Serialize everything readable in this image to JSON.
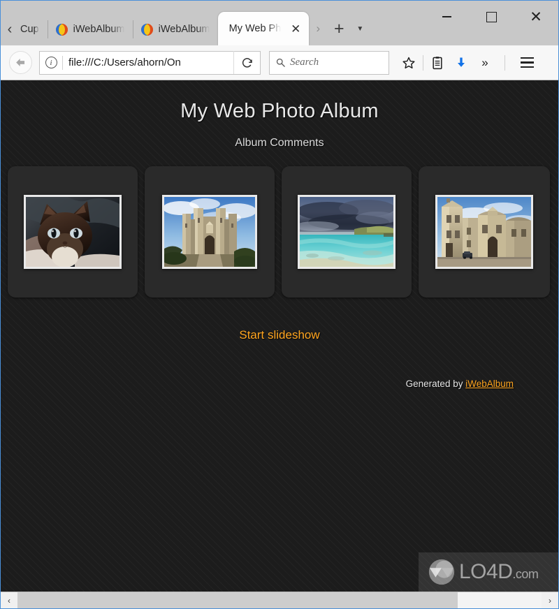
{
  "browser": {
    "tabs": [
      {
        "label": "Cup",
        "favicon": "none",
        "active": false,
        "partial": true
      },
      {
        "label": "iWebAlbum",
        "favicon": "iwebalbum-favicon",
        "active": false,
        "partial": false
      },
      {
        "label": "iWebAlbum",
        "favicon": "iwebalbum-favicon",
        "active": false,
        "partial": false
      },
      {
        "label": "My Web Ph",
        "favicon": "none",
        "active": true,
        "partial": false
      }
    ],
    "tab_close_glyph": "✕",
    "tab_scroll_left_glyph": "‹",
    "tab_scroll_right_glyph": "›",
    "new_tab_glyph": "+",
    "list_all_tabs_glyph": "▼",
    "window_controls": {
      "minimize": "–",
      "maximize": "□",
      "close": "✕"
    },
    "toolbar": {
      "back_label": "Back",
      "info_glyph": "i",
      "url": "file:///C:/Users/ahorn/On",
      "reload_label": "Reload",
      "search_placeholder": "Search",
      "bookmark_label": "Bookmark this page",
      "library_label": "Library",
      "downloads_label": "Downloads",
      "overflow_glyph": "»",
      "menu_label": "Open menu"
    }
  },
  "page": {
    "title": "My Web Photo Album",
    "comments": "Album Comments",
    "thumbnails": [
      {
        "caption": "siamese-cat-photo"
      },
      {
        "caption": "castel-del-monte-photo"
      },
      {
        "caption": "turquoise-beach-storm-photo"
      },
      {
        "caption": "baroque-church-photo"
      }
    ],
    "slideshow_link": "Start slideshow",
    "footer_prefix": "Generated by ",
    "footer_brand": "iWebAlbum",
    "colors": {
      "background": "#1c1c1c",
      "card": "#2a2a2a",
      "accent": "#ffa51f",
      "text": "#e8e8e8"
    }
  },
  "watermark": {
    "text": "LO4D",
    "suffix": ".com"
  },
  "scrollbar": {
    "left_glyph": "‹",
    "right_glyph": "›"
  }
}
